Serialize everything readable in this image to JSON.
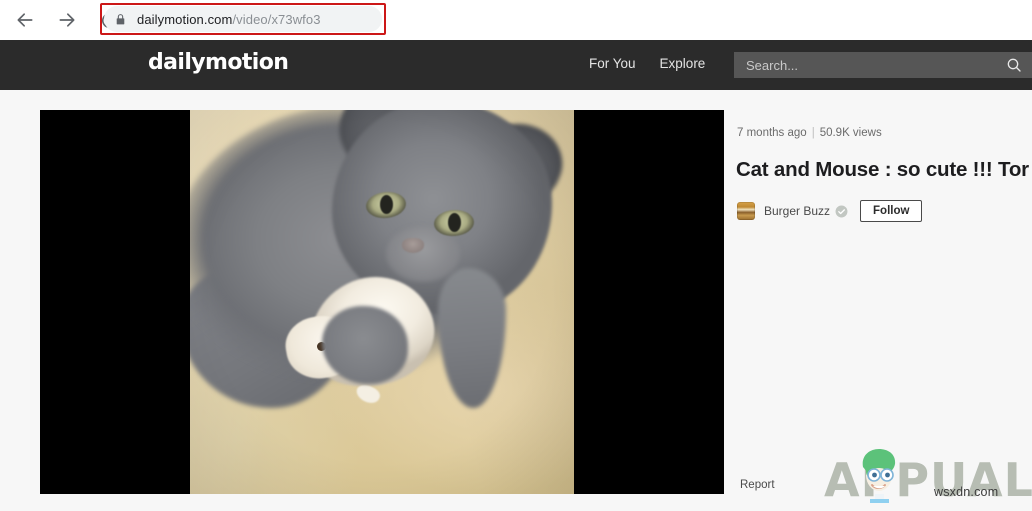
{
  "browser": {
    "back_icon": "arrow-left-icon",
    "forward_icon": "arrow-right-icon",
    "reload_icon": "reload-icon",
    "lock_icon": "lock-icon",
    "url_domain": "dailymotion.com",
    "url_path": "/video/x73wfo3",
    "highlight_color": "#cc1717"
  },
  "header": {
    "logo": "dailymotion",
    "nav": [
      {
        "label": "For You"
      },
      {
        "label": "Explore"
      }
    ],
    "search": {
      "placeholder": "Search...",
      "value": "",
      "icon": "search-icon"
    },
    "background_color": "#2b2b2b"
  },
  "player": {
    "aspect": "letterboxed",
    "background_color": "#000000",
    "scene": "gray kitten with white hamster on beige blanket"
  },
  "video": {
    "published": "7 months ago",
    "separator": "|",
    "views": "50.9K views",
    "title": "Cat and Mouse : so cute !!! Tor",
    "channel": {
      "name": "Burger Buzz",
      "avatar": "burger-avatar",
      "verified_icon": "verified-check-icon"
    },
    "follow_label": "Follow",
    "report_label": "Report"
  },
  "watermark": {
    "brand": "APPUALS",
    "site": "wsxdn.com",
    "brand_color": "#b7bdb3",
    "mascot": "appuals-mascot-icon"
  }
}
